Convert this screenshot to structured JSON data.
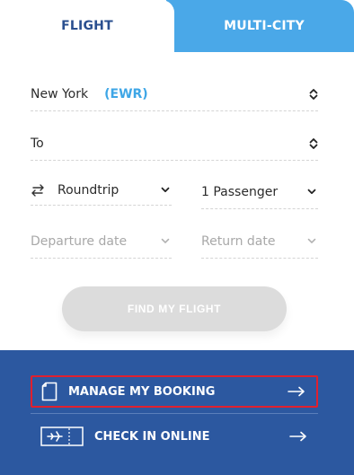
{
  "tabs": [
    {
      "label": "FLIGHT",
      "active": true
    },
    {
      "label": "MULTI-CITY",
      "active": false
    }
  ],
  "form": {
    "from_city": "New York",
    "from_code": "(EWR)",
    "to_placeholder": "To",
    "trip_type": "Roundtrip",
    "passengers": "1 Passenger",
    "departure_placeholder": "Departure date",
    "return_placeholder": "Return date",
    "find_button": "FIND MY FLIGHT"
  },
  "links": {
    "manage_booking": "MANAGE MY BOOKING",
    "check_in": "CHECK IN ONLINE"
  },
  "icons": {
    "swap": "swap-arrows-icon",
    "updown": "up-down-chevron-icon",
    "dropdown": "chevron-down-icon",
    "document": "document-icon",
    "boarding_pass": "boarding-pass-icon",
    "arrow": "arrow-right-icon"
  },
  "colors": {
    "brand_blue": "#2c58a0",
    "tab_blue": "#4aa8e8",
    "accent_code": "#3ea6e6",
    "highlight_border": "#e0202e",
    "button_disabled": "#dcdcdc"
  }
}
